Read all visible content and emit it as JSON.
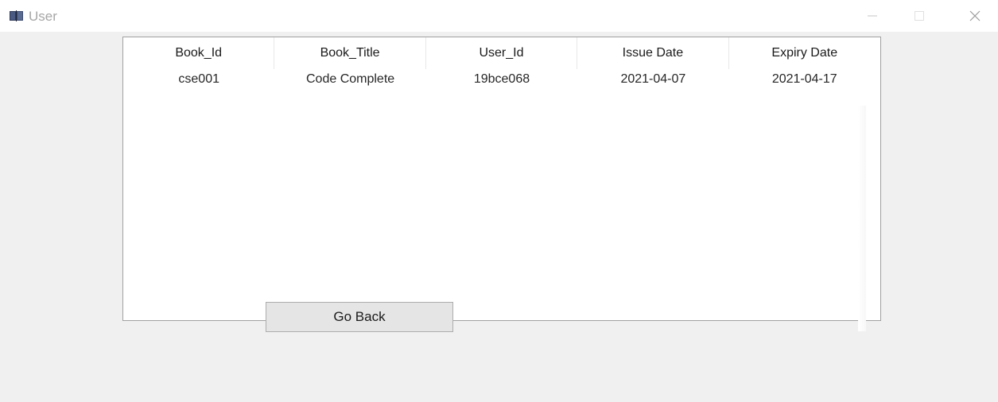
{
  "window": {
    "title": "User",
    "icon": "book-icon",
    "controls": [
      "minimize-icon",
      "maximize-icon",
      "close-icon"
    ]
  },
  "table": {
    "columns": [
      "Book_Id",
      "Book_Title",
      "User_Id",
      "Issue Date",
      "Expiry Date"
    ],
    "rows": [
      [
        "cse001",
        "Code Complete",
        "19bce068",
        "2021-04-07",
        "2021-04-17"
      ]
    ]
  },
  "actions": {
    "go_back_label": "Go Back"
  }
}
